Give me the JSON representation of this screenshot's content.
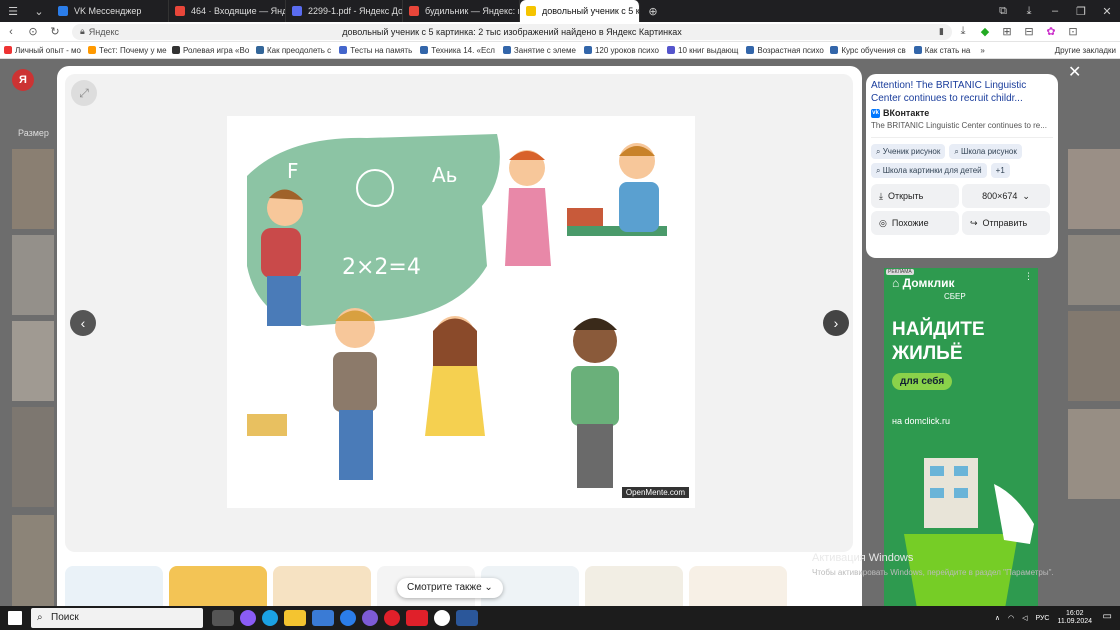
{
  "tabs": [
    {
      "label": "VK Мессенджер",
      "color": "#2b7de9"
    },
    {
      "label": "464 · Входящие — Яндекс",
      "color": "#e8463a"
    },
    {
      "label": "2299-1.pdf - Яндекс Доку",
      "color": "#5a6cf0"
    },
    {
      "label": "будильник — Яндекс: наш",
      "color": "#e8463a"
    },
    {
      "label": "довольный ученик с 5 к",
      "color": "#f5c400",
      "active": true
    }
  ],
  "address": {
    "site": "Яндекс",
    "title": "довольный ученик с 5 картинка: 2 тыс изображений найдено в Яндекс Картинках"
  },
  "bookmarks": [
    "Личный опыт - мо",
    "Тест: Почему у ме",
    "Ролевая игра «Во",
    "Как преодолеть с",
    "Тесты на память",
    "Техника 14. «Есл",
    "Занятие с элеме",
    "120 уроков психо",
    "10 книг выдающ",
    "Возрастная психо",
    "Курс обучения св",
    "Как стать на"
  ],
  "bookmarks_other": "Другие закладки",
  "page": {
    "size_filter": "Размер",
    "logo": "Я"
  },
  "viewer": {
    "watermark": "OpenMente.com",
    "see_also": "Смотрите также"
  },
  "side": {
    "title": "Attention! The BRITANIC Linguistic Center continues to recruit childr...",
    "source": "ВКонтакте",
    "desc": "The BRITANIC Linguistic Center continues to re...",
    "chips": [
      "Ученик рисунок",
      "Школа рисунок",
      "Школа картинки для детей",
      "+1"
    ],
    "open_label": "Открыть",
    "size_label": "800×674",
    "similar_label": "Похожие",
    "send_label": "Отправить"
  },
  "ad": {
    "tag": "РЕКЛАМА",
    "logo": "Домклик",
    "sub": "СБЕР",
    "headline": "НАЙДИТЕ\nЖИЛЬЁ",
    "pill": "для себя",
    "url": "на domclick.ru"
  },
  "activation": {
    "line1": "Активация Windows",
    "line2": "Чтобы активировать Windows, перейдите в раздел \"Параметры\"."
  },
  "taskbar": {
    "search": "Поиск",
    "lang": "РУС",
    "time": "16:02",
    "date": "11.09.2024"
  }
}
